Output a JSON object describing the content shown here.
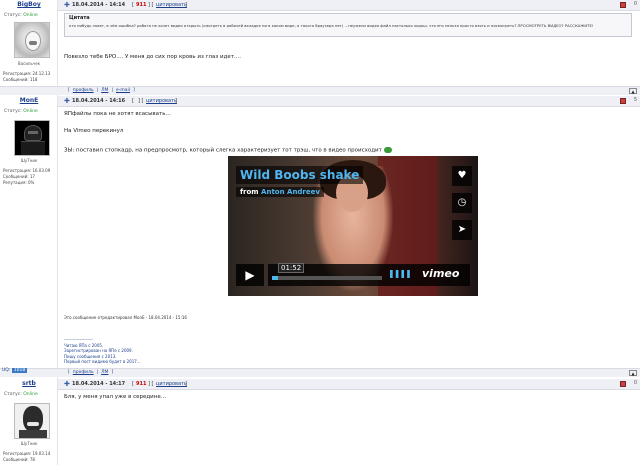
{
  "posts": [
    {
      "username": "BigBoy",
      "status_label": "Статус:",
      "status_value": "Online",
      "avatar_caption": "Васильчек",
      "reg_line": "Регистрация: 24.12.13",
      "msgs_line": "Сообщений: 118",
      "date": "18.04.2014 - 14:14",
      "pm_num": "911",
      "quote_label": "цитировать",
      "quote": {
        "title": "Цитата",
        "text": "кто нибудь знает, в чём ошибка? работа не хочет видео открыть (смотреть в рабочей вкладке ни в каком виде, а такого браузера нет) ...неужели видео файл настолько хорош, что его нельзя просто взять и посмотреть? ПРОСМОТРЕТЬ ВИДЕО? РАССКАЖИТЕ!"
      },
      "body": "Повезло тебе БРО.... У меня до сих пор кровь из глаз идет....",
      "footer_links": [
        "профиль",
        "ЛМ",
        "e-mail"
      ]
    },
    {
      "username": "MonE",
      "status_label": "Статус:",
      "status_value": "Online",
      "avatar_caption": "ШуТник",
      "reg_line": "Регистрация: 16.03.09",
      "msgs_line": "Сообщений: 17",
      "rep_line": "Репутация: 0%",
      "date": "18.04.2014 - 14:16",
      "pm_num": "",
      "quote_label": "цитировать",
      "post_count": "5",
      "lines": [
        "ЯПфайлы пока не хотят всасывать...",
        "На Vimeo перекинул",
        "ЗЫ: поставил стопкадр, на предпросмотр, который слегка характеризует тот трэш, что в видео происходит"
      ],
      "video": {
        "title": "Wild Boobs shake",
        "by_prefix": "from",
        "author": "Anton Andreev",
        "time": "01:52",
        "brand": "vimeo",
        "progress": 0.05
      },
      "edited_note": "Это сообщение отредактировал MonE - 18.04.2014 - 15:16",
      "signature": [
        "--------------------",
        "Читаю ЯПа с 2005.",
        "Зарегистрирован на ЯПе с 2009.",
        "Пишу сообщения с 2013.",
        "Первый пост видимо будет в 2017..."
      ],
      "footer_links": [
        "профиль",
        "ЛМ"
      ],
      "uq_label": "UQ:",
      "uq_value": "1018"
    },
    {
      "username": "srtb",
      "status_label": "Статус:",
      "status_value": "Online",
      "avatar_caption": "ШуТник",
      "reg_line": "Регистрация: 19.03.14",
      "msgs_line": "Сообщений: 78",
      "date": "18.04.2014 - 14:17",
      "pm_num": "911",
      "quote_label": "цитировать",
      "body": "Бля, у меня упал уже в середине...",
      "counter": "0"
    }
  ]
}
